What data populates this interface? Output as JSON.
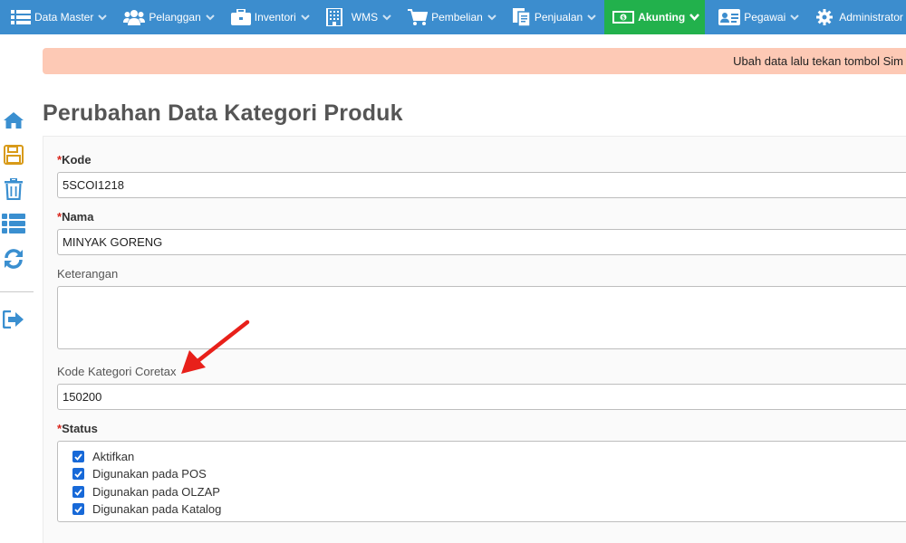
{
  "nav": {
    "items": [
      {
        "label": "Data Master",
        "icon": "list-icon"
      },
      {
        "label": "Pelanggan",
        "icon": "users-icon"
      },
      {
        "label": "Inventori",
        "icon": "briefcase-icon"
      },
      {
        "label": "WMS",
        "icon": "building-icon"
      },
      {
        "label": "Pembelian",
        "icon": "cart-icon"
      },
      {
        "label": "Penjualan",
        "icon": "document-icon"
      },
      {
        "label": "Akunting",
        "icon": "money-icon",
        "active": true
      },
      {
        "label": "Pegawai",
        "icon": "id-card-icon"
      },
      {
        "label": "Administrator",
        "icon": "gear-icon"
      }
    ]
  },
  "alert": {
    "text": "Ubah data lalu tekan tombol Sim"
  },
  "sidebar": {
    "items": [
      {
        "icon": "home-icon"
      },
      {
        "icon": "save-icon"
      },
      {
        "icon": "trash-icon"
      },
      {
        "icon": "list-icon"
      },
      {
        "icon": "refresh-icon"
      },
      {
        "icon": "sign-out-icon"
      }
    ]
  },
  "page": {
    "title": "Perubahan Data Kategori Produk"
  },
  "form": {
    "required_mark": "*",
    "kode": {
      "label": "Kode",
      "value": "5SCOI1218"
    },
    "nama": {
      "label": "Nama",
      "value": "MINYAK GORENG"
    },
    "keterangan": {
      "label": "Keterangan",
      "value": ""
    },
    "coretax": {
      "label": "Kode Kategori Coretax",
      "value": "150200"
    },
    "status": {
      "label": "Status",
      "options": [
        {
          "label": "Aktifkan",
          "checked": true
        },
        {
          "label": "Digunakan pada POS",
          "checked": true
        },
        {
          "label": "Digunakan pada OLZAP",
          "checked": true
        },
        {
          "label": "Digunakan pada Katalog",
          "checked": true
        }
      ]
    }
  },
  "colors": {
    "nav_bg": "#3c8dce",
    "nav_active": "#22b14c",
    "alert_bg": "#fdc9b5",
    "required": "#d9261c",
    "checkbox": "#1769d8",
    "annotation_arrow": "#e8201a"
  }
}
